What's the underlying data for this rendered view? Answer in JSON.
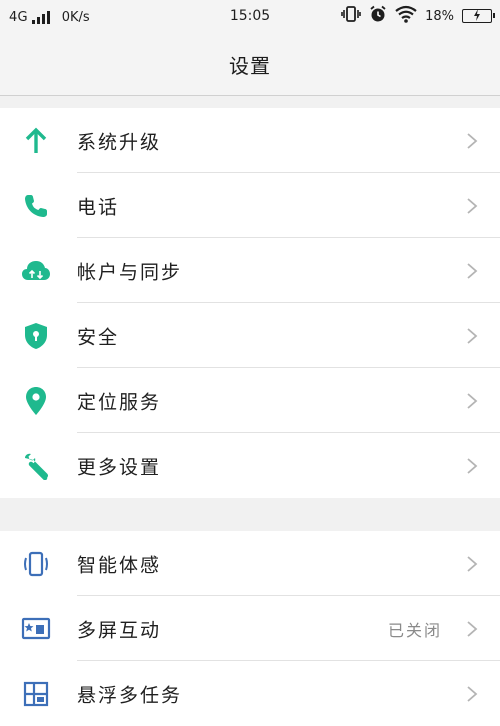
{
  "status_bar": {
    "network": "4G",
    "speed": "0K/s",
    "time": "15:05",
    "battery_percent": "18%"
  },
  "header": {
    "title": "设置"
  },
  "colors": {
    "accent_green": "#1fb98e",
    "accent_blue": "#3d6fb8",
    "chevron": "#b4b4b4"
  },
  "settings_group_1": [
    {
      "label": "系统升级",
      "icon": "arrow-up-icon"
    },
    {
      "label": "电话",
      "icon": "phone-icon"
    },
    {
      "label": "帐户与同步",
      "icon": "cloud-sync-icon"
    },
    {
      "label": "安全",
      "icon": "shield-icon"
    },
    {
      "label": "定位服务",
      "icon": "location-pin-icon"
    },
    {
      "label": "更多设置",
      "icon": "wrench-icon"
    }
  ],
  "settings_group_2": [
    {
      "label": "智能体感",
      "icon": "motion-sense-icon"
    },
    {
      "label": "多屏互动",
      "icon": "screen-cast-icon",
      "value": "已关闭"
    },
    {
      "label": "悬浮多任务",
      "icon": "multitask-icon"
    }
  ]
}
